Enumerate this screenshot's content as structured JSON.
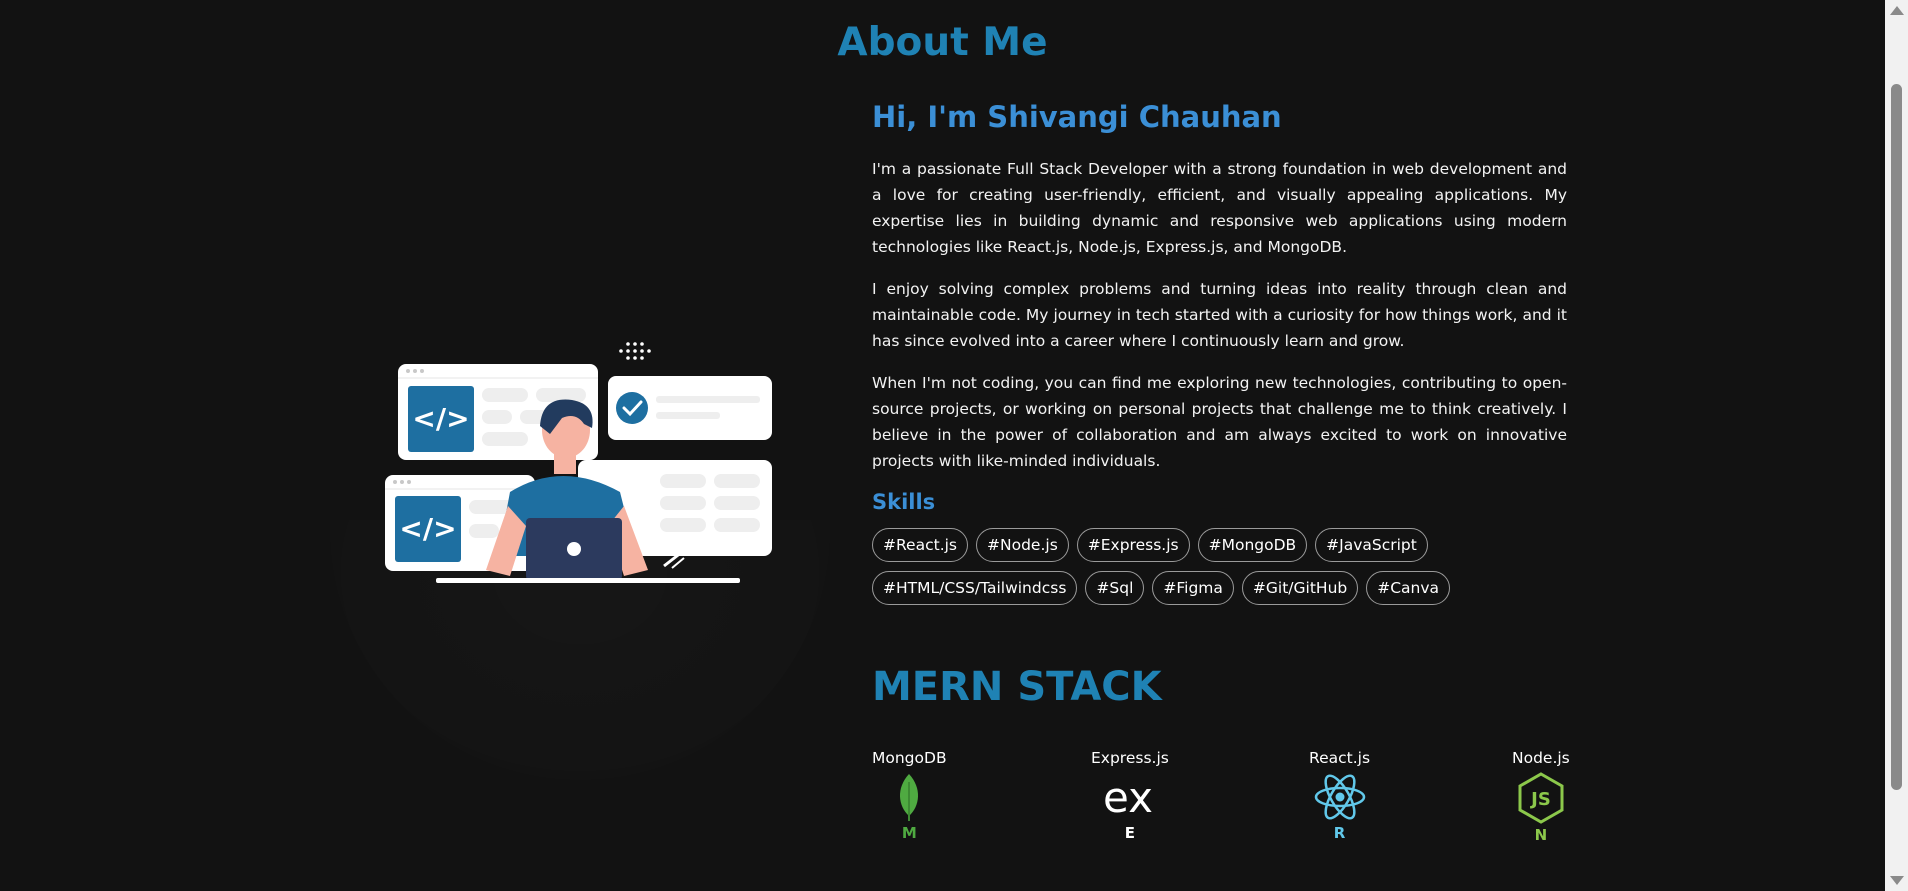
{
  "section": {
    "title": "About Me"
  },
  "about": {
    "greeting": "Hi, I'm Shivangi Chauhan",
    "paragraphs": [
      "I'm a passionate Full Stack Developer with a strong foundation in web development and a love for creating user-friendly, efficient, and visually appealing applications. My expertise lies in building dynamic and responsive web applications using modern technologies like React.js, Node.js, Express.js, and MongoDB.",
      "I enjoy solving complex problems and turning ideas into reality through clean and maintainable code. My journey in tech started with a curiosity for how things work, and it has since evolved into a career where I continuously learn and grow.",
      "When I'm not coding, you can find me exploring new technologies, contributing to open-source projects, or working on personal projects that challenge me to think creatively. I believe in the power of collaboration and am always excited to work on innovative projects with like-minded individuals."
    ]
  },
  "skills": {
    "title": "Skills",
    "tags": [
      "#React.js",
      "#Node.js",
      "#Express.js",
      "#MongoDB",
      "#JavaScript",
      "#HTML/CSS/Tailwindcss",
      "#Sql",
      "#Figma",
      "#Git/GitHub",
      "#Canva"
    ]
  },
  "stack": {
    "title": "MERN STACK",
    "items": [
      {
        "label": "MongoDB",
        "letter": "M",
        "icon": "mongodb-leaf-icon",
        "color": "#4faa41"
      },
      {
        "label": "Express.js",
        "letter": "E",
        "icon": "express-icon",
        "color": "#ffffff"
      },
      {
        "label": "React.js",
        "letter": "R",
        "icon": "react-atom-icon",
        "color": "#61c8ea"
      },
      {
        "label": "Node.js",
        "letter": "N",
        "icon": "nodejs-hexagon-icon",
        "color": "#8cc84b"
      }
    ]
  },
  "colors": {
    "background": "#121212",
    "title_blue": "#1f82b4",
    "heading_blue": "#3b8fd6",
    "illustration_blue": "#1e6fa1",
    "skin": "#f6b3a2",
    "hair": "#223b5e"
  }
}
